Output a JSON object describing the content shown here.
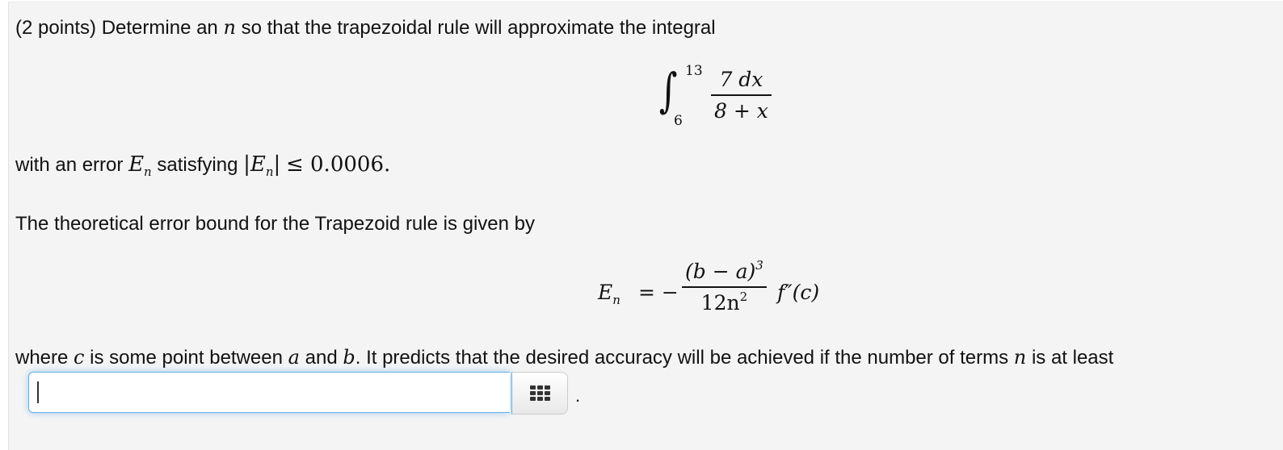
{
  "problem": {
    "intro_prefix": "(2 points) Determine an",
    "intro_var": "n",
    "intro_suffix": "so that the trapezoidal rule will approximate the integral",
    "integral": {
      "lower": "6",
      "upper": "13",
      "numerator": "7 dx",
      "denominator": "8 + x"
    },
    "error_line_prefix": "with an error",
    "error_symbol": "E",
    "error_subscript": "n",
    "error_line_mid": "satisfying",
    "error_condition": "≤ 0.0006.",
    "bound_intro": "The theoretical error bound for the Trapezoid rule is given by",
    "formula": {
      "lhs": "E",
      "lhs_sub": "n",
      "equals": "= −",
      "numerator": "(b − a)",
      "numerator_exp": "3",
      "denominator": "12n",
      "denominator_exp": "2",
      "rhs": "f″(c)"
    },
    "conclusion": {
      "part1": "where",
      "var_c": "c",
      "part2": "is some point between",
      "var_a": "a",
      "part3": "and",
      "var_b": "b",
      "part4": ". It predicts that the desired accuracy will be achieved if the number of terms",
      "var_n": "n",
      "part5": "is at least"
    }
  },
  "answer": {
    "value": "",
    "placeholder": "",
    "keypad_icon": "keypad-grid-icon",
    "trailing": "."
  }
}
